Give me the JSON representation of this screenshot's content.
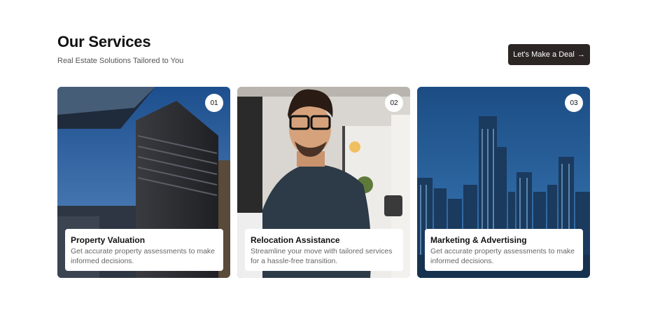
{
  "header": {
    "title": "Our Services",
    "subtitle": "Real Estate Solutions Tailored to You",
    "cta_label": "Let's Make a Deal",
    "cta_icon": "arrow-right-icon"
  },
  "cards": [
    {
      "number": "01",
      "title": "Property Valuation",
      "description": "Get accurate property assessments to make informed decisions."
    },
    {
      "number": "02",
      "title": "Relocation Assistance",
      "description": "Streamline your move with tailored services for a hassle-free transition."
    },
    {
      "number": "03",
      "title": "Marketing & Advertising",
      "description": "Get accurate property assessments to make informed decisions."
    }
  ],
  "colors": {
    "button": "#2b2523",
    "card_text": "#111111",
    "description": "#666666"
  }
}
